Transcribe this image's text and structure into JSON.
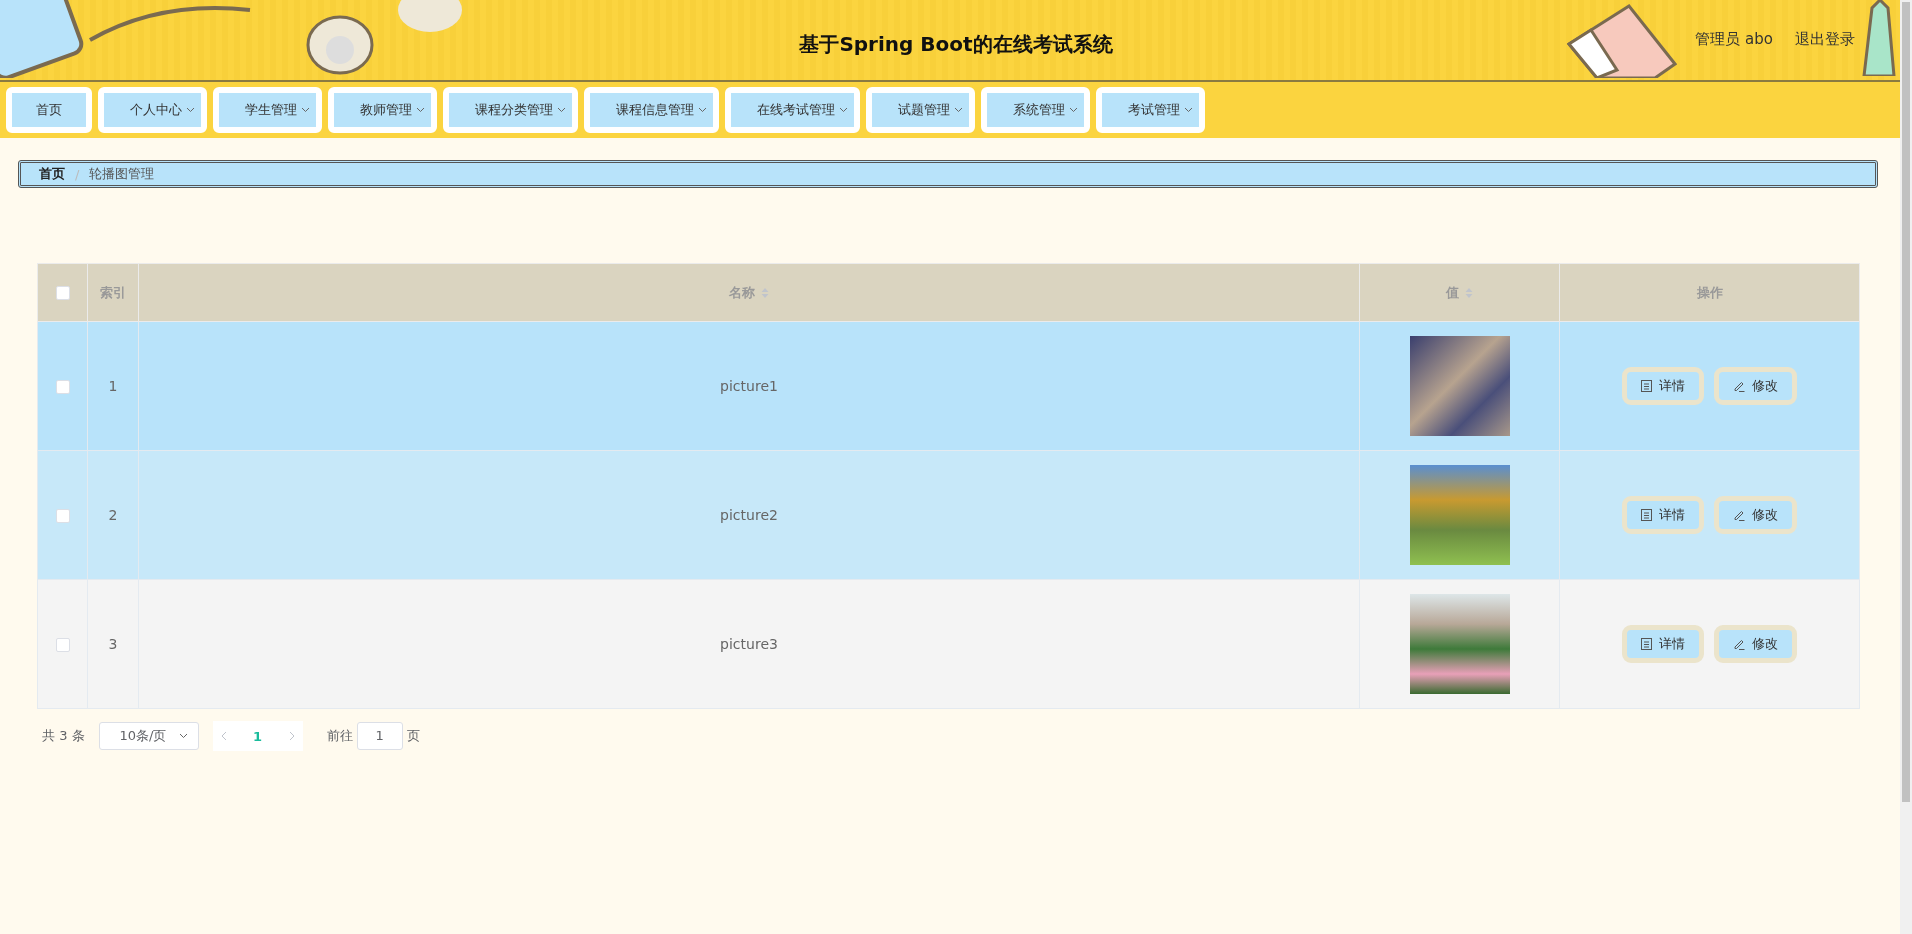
{
  "header": {
    "title": "基于Spring Boot的在线考试系统",
    "user": "管理员 abo",
    "logout": "退出登录"
  },
  "nav": [
    {
      "label": "首页",
      "has_menu": false
    },
    {
      "label": "个人中心",
      "has_menu": true
    },
    {
      "label": "学生管理",
      "has_menu": true
    },
    {
      "label": "教师管理",
      "has_menu": true
    },
    {
      "label": "课程分类管理",
      "has_menu": true
    },
    {
      "label": "课程信息管理",
      "has_menu": true
    },
    {
      "label": "在线考试管理",
      "has_menu": true
    },
    {
      "label": "试题管理",
      "has_menu": true
    },
    {
      "label": "系统管理",
      "has_menu": true
    },
    {
      "label": "考试管理",
      "has_menu": true
    }
  ],
  "breadcrumb": {
    "separator": "/",
    "items": [
      {
        "label": "首页",
        "current": false
      },
      {
        "label": "轮播图管理",
        "current": true
      }
    ]
  },
  "table": {
    "select_all": {
      "checked": false
    },
    "columns": [
      {
        "label": "索引",
        "sortable": false
      },
      {
        "label": "名称",
        "sortable": true
      },
      {
        "label": "值",
        "sortable": true
      },
      {
        "label": "操作",
        "sortable": false
      }
    ],
    "rows": [
      {
        "checked": false,
        "highlighted": true,
        "index": "1",
        "name": "picture1",
        "actions": [
          {
            "kind": "detail",
            "label": "详情"
          },
          {
            "kind": "edit",
            "label": "修改"
          }
        ]
      },
      {
        "checked": false,
        "highlighted": false,
        "index": "2",
        "name": "picture2",
        "actions": [
          {
            "kind": "detail",
            "label": "详情"
          },
          {
            "kind": "edit",
            "label": "修改"
          }
        ]
      },
      {
        "checked": false,
        "highlighted": false,
        "index": "3",
        "name": "picture3",
        "actions": [
          {
            "kind": "detail",
            "label": "详情"
          },
          {
            "kind": "edit",
            "label": "修改"
          }
        ]
      }
    ]
  },
  "pagination": {
    "total": "共 3 条",
    "page_size": "10条/页",
    "pages": [
      {
        "label": "1",
        "selected": true
      }
    ],
    "goto_label": "前往",
    "goto_value": "1",
    "page_suffix": "页"
  }
}
